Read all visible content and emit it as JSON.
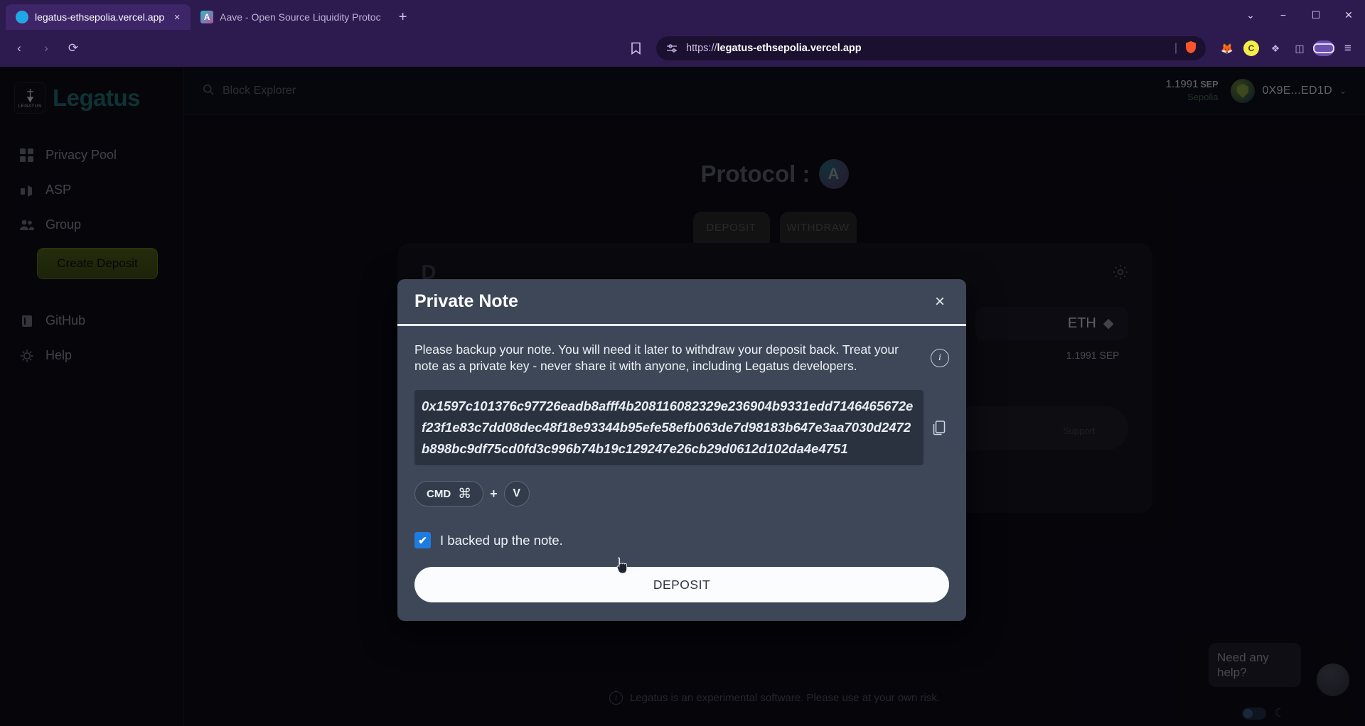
{
  "browser": {
    "tabs": [
      {
        "title": "legatus-ethsepolia.vercel.app",
        "favicon": "globe-icon",
        "active": true,
        "close": "×"
      },
      {
        "title": "Aave - Open Source Liquidity Protoc",
        "favicon": "aave-icon",
        "active": false,
        "close": ""
      }
    ],
    "new_tab_label": "+",
    "window_controls": {
      "minimize": "−",
      "maximize": "☐",
      "close": "✕",
      "chevron": "⌄"
    },
    "nav": {
      "back": "‹",
      "forward": "›",
      "reload": "⟳",
      "bookmark": "☐"
    },
    "omnibox": {
      "scheme": "https://",
      "host": "legatus-ethsepolia.vercel.app",
      "site_settings_icon": "site-settings-icon",
      "shield_icon": "brave-shield-icon",
      "divider": "|"
    },
    "extensions": {
      "metamask": "🦊",
      "coinbase_letter": "C",
      "puzzle": "❖",
      "panel": "◫",
      "menu": "≡"
    }
  },
  "sidebar": {
    "logo": {
      "mark_label": "LEGATUS",
      "wordmark": "Legatus"
    },
    "items": [
      {
        "label": "Privacy Pool",
        "icon": "grid-icon"
      },
      {
        "label": "ASP",
        "icon": "antenna-icon"
      },
      {
        "label": "Group",
        "icon": "users-icon"
      }
    ],
    "create_deposit_label": "Create Deposit",
    "bottom_items": [
      {
        "label": "GitHub",
        "icon": "github-icon"
      },
      {
        "label": "Help",
        "icon": "help-icon"
      }
    ]
  },
  "topbar": {
    "search_placeholder": "Block Explorer",
    "search_icon": "search-icon",
    "balance_amount": "1.1991",
    "balance_symbol": "SEP",
    "network": "Sepolia",
    "wallet_address": "0X9E...ED1D",
    "wallet_caret": "⌄"
  },
  "page": {
    "protocol_label": "Protocol :",
    "protocol_badge": "A",
    "mode_tabs": [
      {
        "label": "DEPOSIT"
      },
      {
        "label": "WITHDRAW"
      }
    ],
    "panel_title": "D",
    "gear_icon": "settings-gear-icon",
    "asset_name": "ETH",
    "asset_icon": "eth-diamond-icon",
    "asset_balance": "1.1991 SEP",
    "support_label": "Support",
    "footer_text": "Legatus is an experimental software. Please use at your own risk.",
    "footer_icon": "info-icon",
    "chat_text": "Need any help?",
    "theme_icon": "moon-icon"
  },
  "modal": {
    "title": "Private Note",
    "close_label": "×",
    "description": "Please backup your note. You will need it later to withdraw your deposit back. Treat your note as a private key - never share it with anyone, including Legatus developers.",
    "info_icon": "info-icon",
    "note_value": "0x1597c101376c97726eadb8afff4b208116082329e236904b9331edd7146465672ef23f1e83c7dd08dec48f18e93344b95efe58efb063de7d98183b647e3aa7030d2472b898bc9df75cd0fd3c996b74b19c129247e26cb29d0612d102da4e4751",
    "copy_icon": "copy-icon",
    "shortcut": {
      "modifier_label": "CMD",
      "modifier_glyph": "⌘",
      "plus": "+",
      "key": "V"
    },
    "checkbox_checked": true,
    "checkbox_mark": "✔",
    "checkbox_label": "I backed up the note.",
    "deposit_button_label": "DEPOSIT"
  },
  "colors": {
    "accent_teal": "#1e6b6b",
    "checkbox_blue": "#1e7ce0",
    "modal_bg": "#3e4757",
    "note_bg": "#2b323f",
    "browser_chrome": "#2d1b50"
  }
}
